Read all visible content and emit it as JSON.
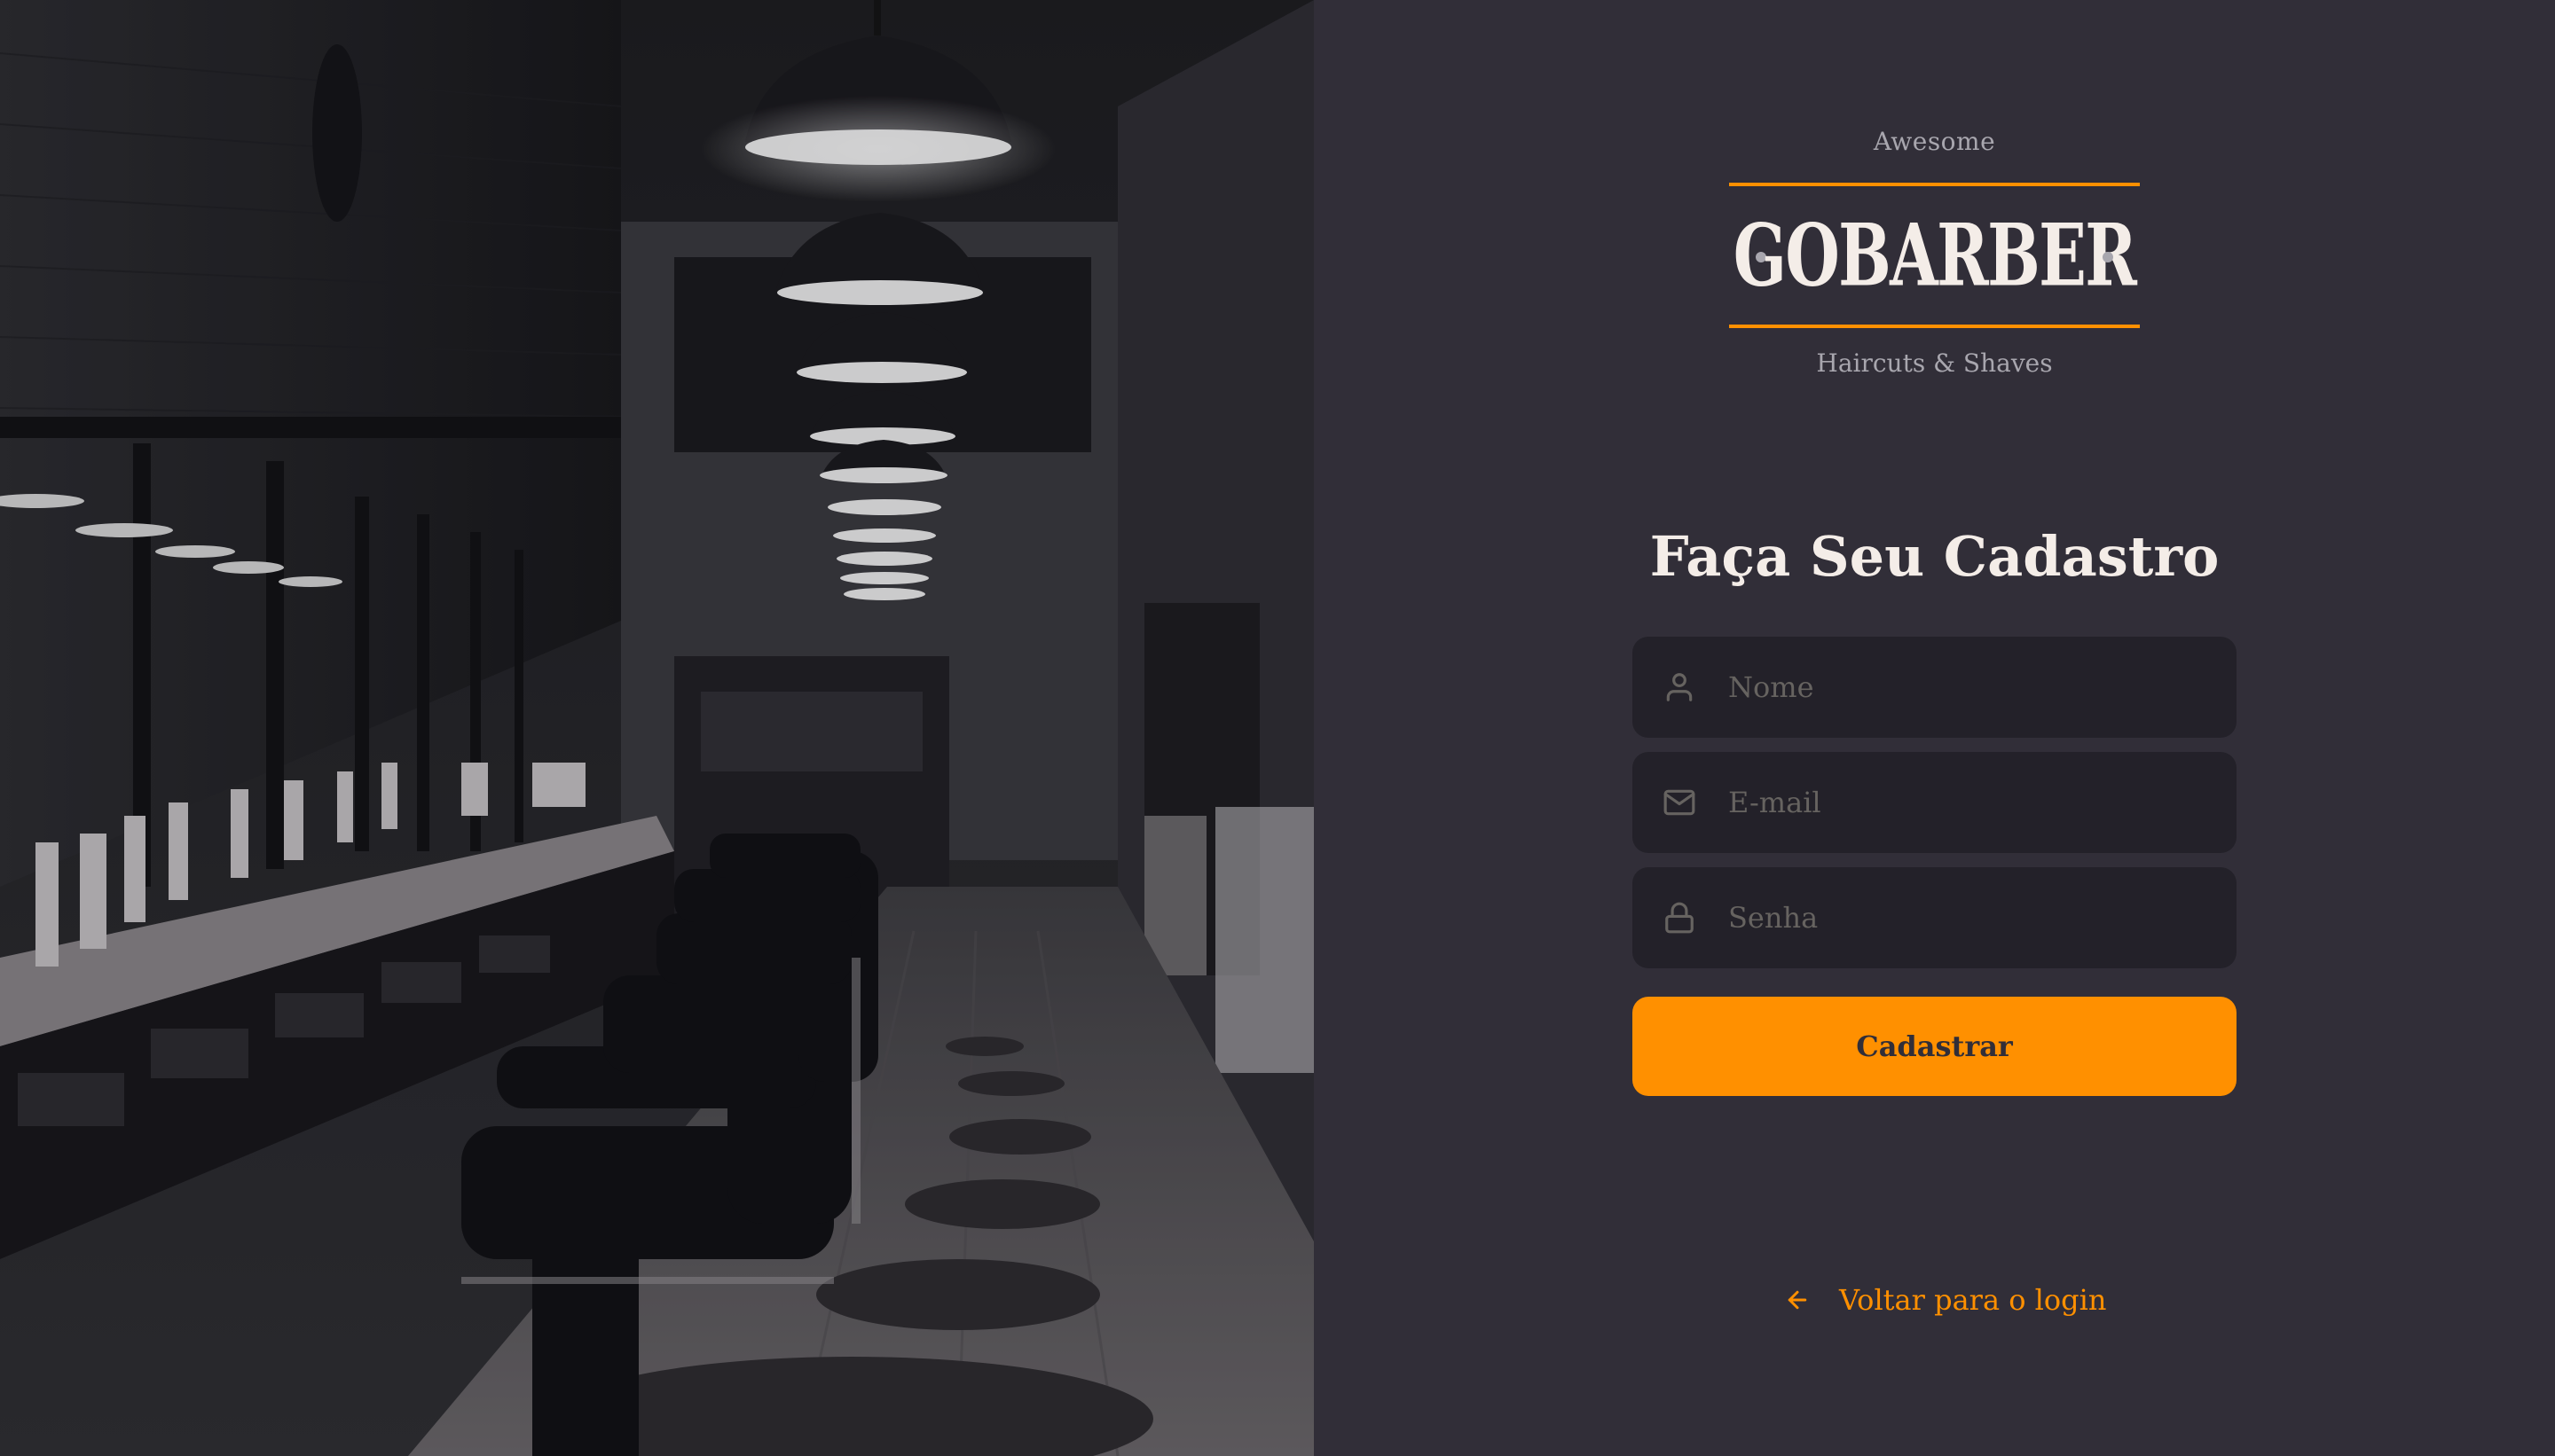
{
  "brand": {
    "top_label": "Awesome",
    "wordmark": "GOBARBER",
    "bottom_label": "Haircuts & Shaves"
  },
  "form": {
    "title": "Faça Seu Cadastro",
    "name_placeholder": "Nome",
    "email_placeholder": "E-mail",
    "password_placeholder": "Senha",
    "submit_label": "Cadastrar"
  },
  "back_link": {
    "label": "Voltar para o login"
  },
  "icons": {
    "name": "user-icon",
    "email": "mail-icon",
    "password": "lock-icon",
    "back": "arrow-left-icon"
  },
  "colors": {
    "background": "#312e38",
    "input_background": "#232129",
    "accent": "#ff9000",
    "text": "#f4ede8",
    "muted": "#666360"
  }
}
